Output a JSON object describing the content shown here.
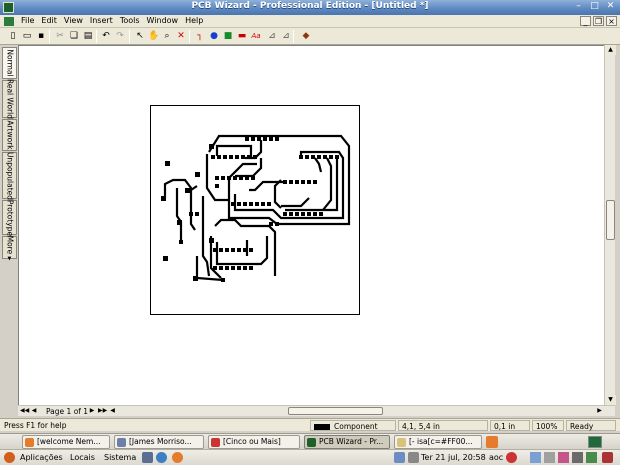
{
  "window": {
    "title": "PCB Wizard - Professional Edition - [Untitled *]",
    "minimize": "–",
    "maximize": "□",
    "close": "✕"
  },
  "menu": {
    "items": [
      "File",
      "Edit",
      "View",
      "Insert",
      "Tools",
      "Window",
      "Help"
    ],
    "mdi_min": "_",
    "mdi_restore": "❐",
    "mdi_close": "×"
  },
  "toolbar": {
    "icons": [
      "new-icon",
      "open-icon",
      "save-icon",
      "print-icon",
      "cut-icon",
      "copy-icon",
      "paste-icon",
      "undo-icon",
      "redo-icon",
      "select-arrow-icon",
      "hand-pan-icon",
      "zoom-icon",
      "delete-icon",
      "track-icon",
      "pad-icon",
      "pad-square-icon",
      "smd-pad-icon",
      "text-icon",
      "dimension-icon",
      "auto-route-icon",
      "component-dropdown-icon"
    ],
    "glyphs": [
      "▯",
      "▭",
      "▪",
      "⎙",
      "✂",
      "❏",
      "▤",
      "↶",
      "↷",
      "↖",
      "✋",
      "⌕",
      "✕",
      "┐",
      "●",
      "■",
      "▬",
      "Aa",
      "⊿",
      "⊿",
      "◆"
    ],
    "colors": {
      "delete": "#cc0000",
      "track": "#cc0000",
      "pad": "#1a3fcc",
      "pad_square": "#1a8a2a",
      "smd": "#cc0000",
      "text": "#cc0000"
    }
  },
  "side_tabs": [
    "Normal",
    "Real World",
    "Artwork",
    "Unpopulated",
    "Prototype",
    "More ▸"
  ],
  "pages": {
    "label": "Page 1 of 1"
  },
  "status": {
    "help": "Press F1 for help",
    "layer": "Component Side",
    "coords": "4,1, 5,4 in",
    "grid": "0,1 in",
    "zoom": "100%",
    "state": "Ready"
  },
  "taskbar": {
    "tasks": [
      "[welcome Nem...",
      "[James Morriso...",
      "[Cinco ou Mais]",
      "PCB Wizard - Pr...",
      "[- isa[c=#FF00..."
    ],
    "date": "Ter 21 jul, 20:58",
    "user": "aoc"
  },
  "panel": {
    "apps": "Aplicações",
    "places": "Locais",
    "system": "Sistema"
  },
  "colors": {
    "copper": "#000000",
    "board_bg": "#ffffff",
    "title_bar": "#5c87c0",
    "chrome": "#ece9d8"
  }
}
